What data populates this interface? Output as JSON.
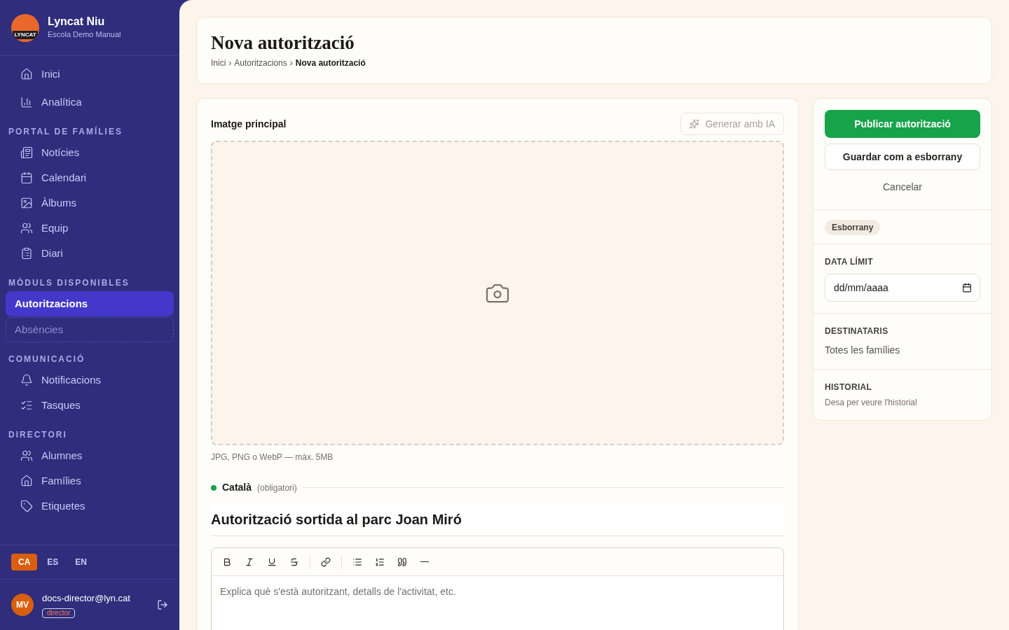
{
  "brand": {
    "logo_text": "LYNCAT",
    "name": "Lyncat Niu",
    "school": "Escola Demo Manual"
  },
  "nav_top": [
    {
      "label": "Inici",
      "selected": false,
      "disabled": false
    },
    {
      "label": "Analítica",
      "selected": false,
      "disabled": false
    }
  ],
  "nav_sections": [
    {
      "title": "PORTAL DE FAMÍLIES",
      "items": [
        {
          "label": "Notícies",
          "selected": false,
          "disabled": false
        },
        {
          "label": "Calendari",
          "selected": false,
          "disabled": false
        },
        {
          "label": "Àlbums",
          "selected": false,
          "disabled": false
        },
        {
          "label": "Equip",
          "selected": false,
          "disabled": false
        },
        {
          "label": "Diari",
          "selected": false,
          "disabled": false
        }
      ]
    },
    {
      "title": "MÒDULS DISPONIBLES",
      "items": [
        {
          "label": "Autoritzacions",
          "selected": true,
          "disabled": false
        },
        {
          "label": "Absències",
          "selected": false,
          "disabled": true
        }
      ]
    },
    {
      "title": "COMUNICACIÓ",
      "items": [
        {
          "label": "Notificacions",
          "selected": false,
          "disabled": false
        },
        {
          "label": "Tasques",
          "selected": false,
          "disabled": false
        }
      ]
    },
    {
      "title": "DIRECTORI",
      "items": [
        {
          "label": "Alumnes",
          "selected": false,
          "disabled": false
        },
        {
          "label": "Famílies",
          "selected": false,
          "disabled": false
        },
        {
          "label": "Etiquetes",
          "selected": false,
          "disabled": false
        }
      ]
    }
  ],
  "languages": [
    {
      "label": "CA",
      "selected": true
    },
    {
      "label": "ES",
      "selected": false
    },
    {
      "label": "EN",
      "selected": false
    }
  ],
  "user": {
    "initials": "MV",
    "email": "docs-director@lyn.cat",
    "role": "director"
  },
  "header": {
    "title": "Nova autorització",
    "breadcrumb": [
      "Inici",
      "Autoritzacions",
      "Nova autorització"
    ],
    "separator": "›"
  },
  "image_section": {
    "label": "Imatge principal",
    "ai_button": "Generar amb IA",
    "hint": "JPG, PNG o WebP — màx. 5MB"
  },
  "language_block": {
    "language": "Català",
    "note": "(obligatori)",
    "color": "#16a34a",
    "title_value": "Autorització sortida al parc Joan Miró",
    "body_placeholder": "Explica què s'està autoritzant, detalls de l'activitat, etc."
  },
  "actions": {
    "publish": "Publicar autorització",
    "draft": "Guardar com a esborrany",
    "cancel": "Cancelar"
  },
  "status_badge": "Esborrany",
  "deadline": {
    "label": "DATA LÍMIT",
    "placeholder": "dd/mm/aaaa"
  },
  "recipients": {
    "label": "DESTINATARIS",
    "value": "Totes les famílies"
  },
  "history": {
    "label": "HISTORIAL",
    "note": "Desa per veure l'historial"
  }
}
